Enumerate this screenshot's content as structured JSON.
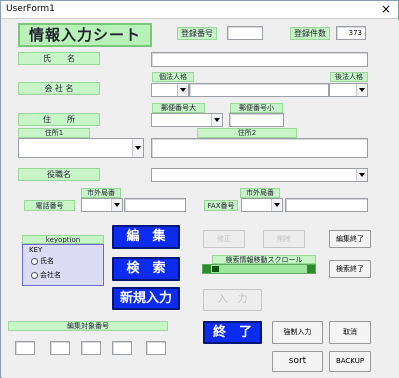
{
  "window": {
    "title": "UserForm1",
    "close": "×"
  },
  "header": {
    "title": "情報入力シート",
    "reg_no_label": "登録番号",
    "reg_no_value": "",
    "reg_count_label": "登録件数",
    "reg_count_value": "373"
  },
  "name": {
    "label": "氏　　名",
    "value": ""
  },
  "company": {
    "label": "会 社 名",
    "legal_before_label": "個法人格",
    "legal_after_label": "後法人格",
    "name_value": ""
  },
  "address": {
    "label": "住　　所",
    "zip_big_label": "郵便番号大",
    "zip_small_label": "郵便番号小",
    "addr1_label": "住所1",
    "addr2_label": "住所2"
  },
  "position": {
    "label": "役職名"
  },
  "phone": {
    "label": "電話番号",
    "area_label": "市外局番",
    "fax_label": "FAX番号",
    "fax_area_label": "市外局番"
  },
  "key_option": {
    "caption": "keyoption",
    "legend": "KEY",
    "options": [
      "氏名",
      "会社名"
    ]
  },
  "buttons": {
    "edit": "編　集",
    "search": "検　索",
    "new_entry": "新規入力",
    "correct": "修正",
    "delete": "削除",
    "edit_end": "編集終了",
    "search_end": "検索終了",
    "input": "入　力",
    "finish": "終　了",
    "force_input": "強制入力",
    "cancel": "取消",
    "sort": "sort",
    "backup": "BACKUP"
  },
  "scroll": {
    "label": "検索情報移動スクロール",
    "position": 0
  },
  "edit_target": {
    "label": "編集対象番号",
    "values": [
      "",
      "",
      "",
      "",
      ""
    ]
  }
}
